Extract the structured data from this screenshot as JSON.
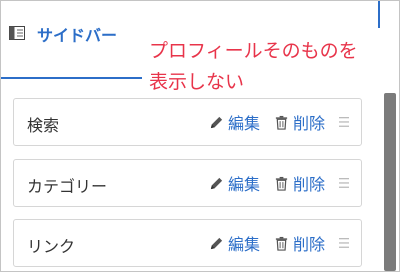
{
  "header": {
    "title": "サイドバー",
    "icon": "sidebar-icon"
  },
  "callout": {
    "line1": "プロフィールそのものを",
    "line2": "表示しない"
  },
  "menu": {
    "items": [
      {
        "label": "検索",
        "edit_label": "編集",
        "delete_label": "削除"
      },
      {
        "label": "カテゴリー",
        "edit_label": "編集",
        "delete_label": "削除"
      },
      {
        "label": "リンク",
        "edit_label": "編集",
        "delete_label": "削除"
      }
    ]
  },
  "colors": {
    "accent": "#2c6ec8",
    "callout_text": "#e8344a",
    "scrollbar": "#7b7b7b"
  }
}
